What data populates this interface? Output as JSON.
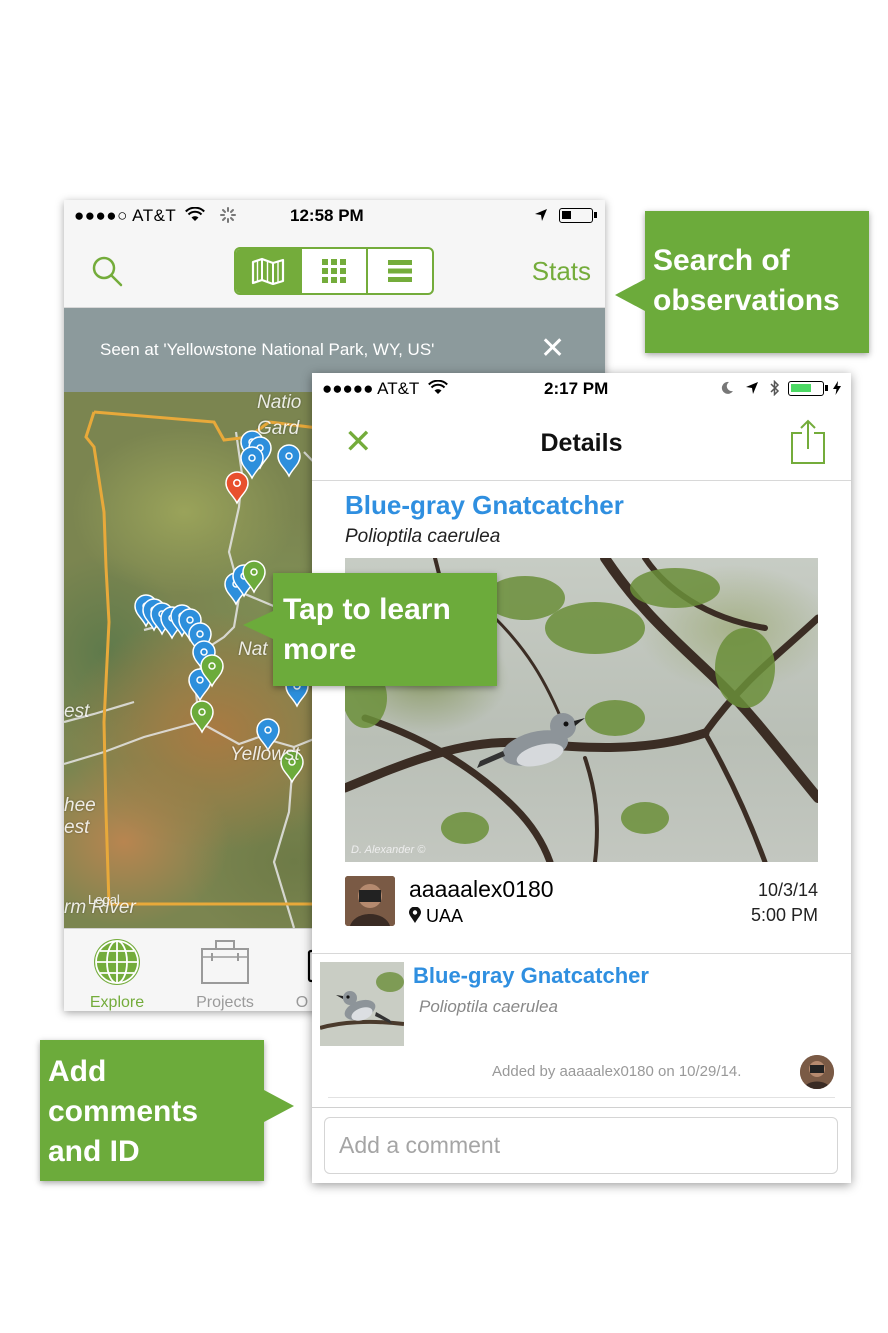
{
  "explore_screen": {
    "status_bar": {
      "carrier": "●●●●○ AT&T",
      "time": "12:58 PM"
    },
    "nav": {
      "stats_label": "Stats"
    },
    "filter_banner": {
      "text": "Seen at 'Yellowstone National Park, WY, US'",
      "close": "✕"
    },
    "map_labels": {
      "national_top": "Natio",
      "gardiner": "Gard",
      "national_mid": "Nat",
      "yellowstone": "Yellowst",
      "west": "est",
      "forest1": "hee",
      "forest2": "est",
      "river": "rm River",
      "legal": "Legal"
    },
    "tabs": [
      {
        "label": "Explore",
        "active": true
      },
      {
        "label": "Projects",
        "active": false
      },
      {
        "label": "O",
        "active": false
      }
    ]
  },
  "details_screen": {
    "status_bar": {
      "carrier": "●●●●● AT&T",
      "time": "2:17 PM"
    },
    "nav": {
      "title": "Details",
      "close": "✕"
    },
    "observation": {
      "common_name": "Blue-gray Gnatcatcher",
      "scientific_name": "Polioptila caerulea",
      "photo_credit": "D. Alexander ©",
      "username": "aaaaalex0180",
      "place": "UAA",
      "date": "10/3/14",
      "time": "5:00 PM"
    },
    "identification": {
      "common_name": "Blue-gray Gnatcatcher",
      "scientific_name": "Polioptila caerulea",
      "added_by": "Added by aaaaalex0180 on 10/29/14."
    },
    "comment": {
      "placeholder": "Add a comment"
    }
  },
  "callouts": {
    "search": "Search of observations",
    "search_line1": "Search of",
    "search_line2": "observations",
    "tap_line1": "Tap to learn",
    "tap_line2": "more",
    "add_line1": "Add",
    "add_line2": "comments",
    "add_line3": "and ID"
  },
  "colors": {
    "brand_green": "#74ac3b",
    "callout_green": "#6cab3b",
    "link_blue": "#2f8fe0",
    "pin_blue": "#2d8fdc",
    "pin_green": "#6cab3b",
    "pin_red": "#e8502d"
  },
  "icons": {
    "search": "search-icon",
    "map_view": "map-icon",
    "grid_view": "grid-icon",
    "list_view": "list-icon",
    "share": "share-icon",
    "location": "location-pin-icon",
    "explore": "globe-icon",
    "projects": "briefcase-icon"
  }
}
